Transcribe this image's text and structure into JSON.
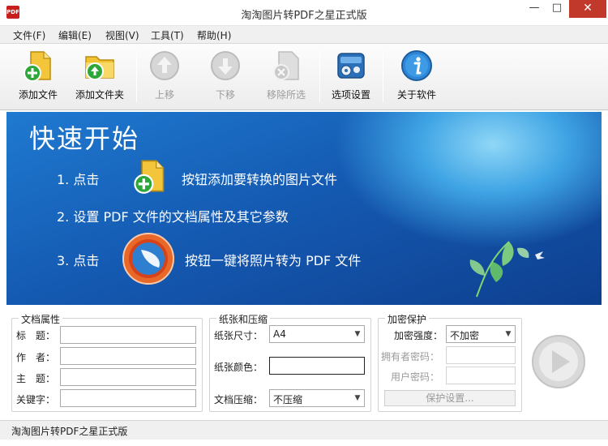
{
  "window": {
    "title": "淘淘图片转PDF之星正式版",
    "app_icon_text": "PDF",
    "minimize": "—",
    "maximize": "□",
    "close": "✕"
  },
  "menu": [
    "文件(F)",
    "编辑(E)",
    "视图(V)",
    "工具(T)",
    "帮助(H)"
  ],
  "toolbar": {
    "add_file": "添加文件",
    "add_folder": "添加文件夹",
    "move_up": "上移",
    "move_down": "下移",
    "remove_selected": "移除所选",
    "options": "选项设置",
    "about": "关于软件"
  },
  "banner": {
    "title": "快速开始",
    "step1_prefix": "1. 点击",
    "step1_suffix": "按钮添加要转换的图片文件",
    "step2": "2. 设置 PDF 文件的文档属性及其它参数",
    "step3_prefix": "3. 点击",
    "step3_suffix": "按钮一键将照片转为 PDF 文件"
  },
  "doc_props": {
    "title": "文档属性",
    "label_title": "标　题：",
    "label_author": "作　者：",
    "label_subject": "主　题：",
    "label_keywords": "关键字：",
    "value_title": "",
    "value_author": "",
    "value_subject": "",
    "value_keywords": ""
  },
  "paper": {
    "title": "纸张和压缩",
    "size_label": "纸张尺寸：",
    "size_value": "A4",
    "color_label": "纸张颜色：",
    "color_value": "#ffffff",
    "compress_label": "文档压缩：",
    "compress_value": "不压缩"
  },
  "encrypt": {
    "title": "加密保护",
    "strength_label": "加密强度：",
    "strength_value": "不加密",
    "owner_pw_label": "拥有者密码：",
    "user_pw_label": "用户密码：",
    "owner_pw_value": "",
    "user_pw_value": "",
    "protect_button": "保护设置..."
  },
  "status": {
    "text": "淘淘图片转PDF之星正式版"
  },
  "colors": {
    "banner_top": "#1f7ad0",
    "banner_bottom": "#0e3f8f",
    "close_button": "#c0392b"
  },
  "icons": {
    "add_file": "add-file-icon",
    "add_folder": "add-folder-icon",
    "move_up": "arrow-up-icon",
    "move_down": "arrow-down-icon",
    "remove": "remove-icon",
    "options": "settings-icon",
    "about": "info-icon",
    "convert": "play-icon"
  }
}
